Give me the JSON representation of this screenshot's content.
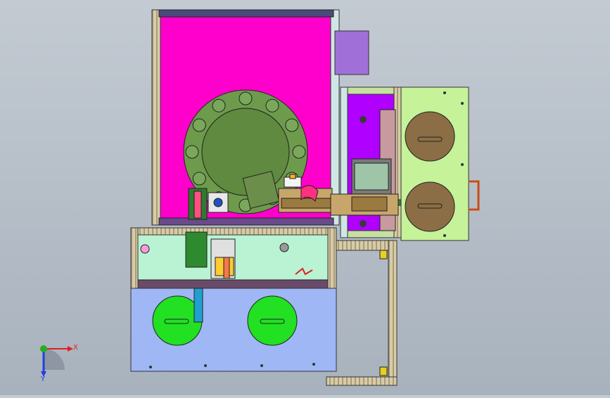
{
  "viewport": {
    "background_top": "#c3cad2",
    "background_bottom": "#a8b2bd"
  },
  "colors": {
    "magenta_enclosure": "#ff00cc",
    "purple_chamber": "#b000ff",
    "lavender_box": "#a070d8",
    "green_plate": "#c6f29a",
    "blue_plate": "#9fb7f5",
    "mint_panel": "#b9f3d4",
    "olive_disc": "#6e9a4c",
    "brown_disc": "#8b6e45",
    "bright_green_disc": "#22e022",
    "frame_tan": "#d7c9a4",
    "frame_dark": "#5a4a6a",
    "tube_orange": "#f07a4a"
  },
  "triad": {
    "x_label": "X",
    "y_label": "Y",
    "x_color": "#e02020",
    "y_color": "#20b020",
    "z_color": "#2040e0"
  }
}
